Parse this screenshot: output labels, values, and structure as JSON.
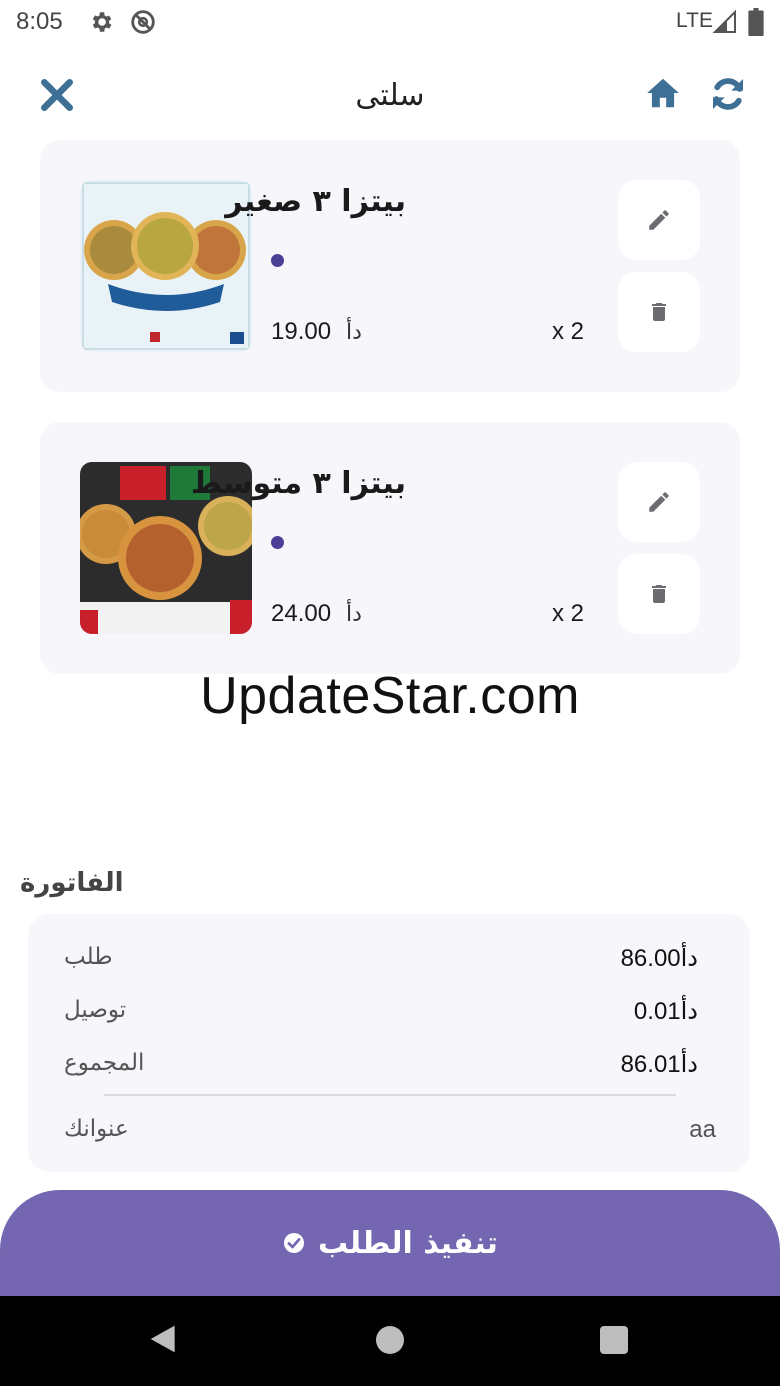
{
  "status_bar": {
    "time": "8:05",
    "network": "LTE"
  },
  "header": {
    "title": "سلتى"
  },
  "cart": {
    "items": [
      {
        "name": "بيتزا ٣ صغير",
        "price": "19.00",
        "currency": "دأ",
        "quantity": "x 2"
      },
      {
        "name": "بيتزا ٣ متوسط",
        "price": "24.00",
        "currency": "دأ",
        "quantity": "x 2"
      }
    ]
  },
  "watermark": "UpdateStar.com",
  "invoice": {
    "heading": "الفاتورة",
    "rows": [
      {
        "label": "طلب",
        "value": "86.00",
        "currency": "دأ"
      },
      {
        "label": "توصيل",
        "value": "0.01",
        "currency": "دأ"
      },
      {
        "label": "المجموع",
        "value": "86.01",
        "currency": "دأ"
      }
    ],
    "address_label": "عنوانك",
    "address_value": "aa"
  },
  "submit": {
    "label": "تنفيذ الطلب"
  },
  "colors": {
    "accent": "#7466b0",
    "card_bg": "#f6f6fb",
    "icon_blue": "#3e6f94",
    "dot": "#4c3f96"
  },
  "icons": [
    "settings-icon",
    "no-sync-icon",
    "signal-icon",
    "battery-icon",
    "close-icon",
    "home-icon",
    "refresh-icon",
    "edit-icon",
    "delete-icon",
    "check-circle-icon"
  ]
}
